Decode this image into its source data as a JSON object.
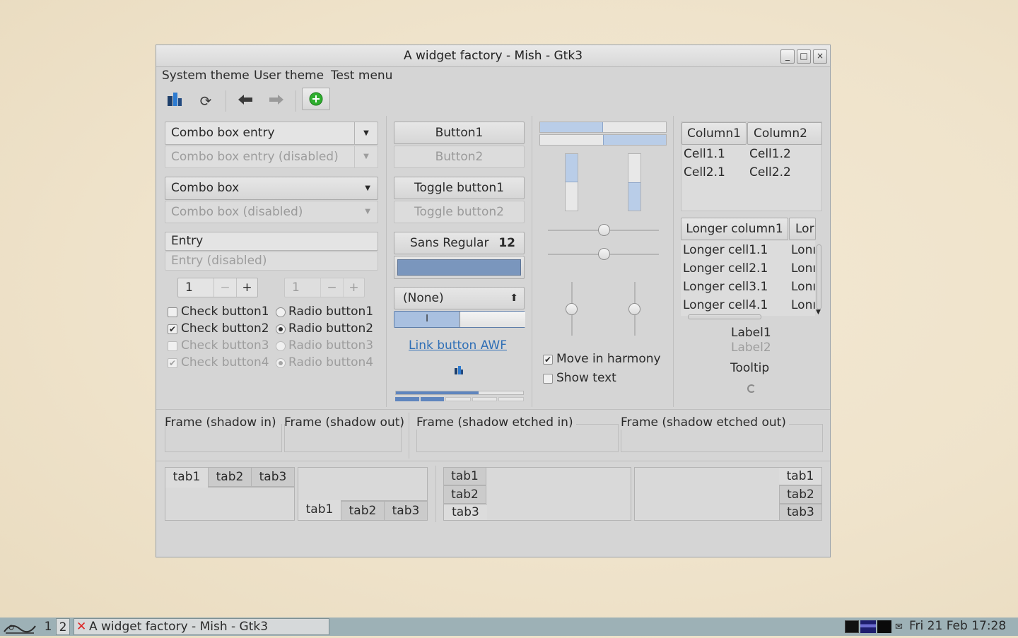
{
  "window": {
    "title": "A widget factory - Mish - Gtk3",
    "wm_buttons": {
      "minimize": "_",
      "maximize": "□",
      "close": "×"
    }
  },
  "menubar": [
    "System theme",
    "User theme",
    "Test menu"
  ],
  "toolbar": {
    "icons": [
      "app-icon",
      "refresh-icon",
      "back-icon",
      "forward-icon",
      "add-icon"
    ]
  },
  "col1": {
    "combo_entry": "Combo box entry",
    "combo_entry_disabled": "Combo box entry (disabled)",
    "combo_box": "Combo box",
    "combo_box_disabled": "Combo box (disabled)",
    "entry": "Entry",
    "entry_disabled": "Entry (disabled)",
    "spin1": {
      "value": "1",
      "minus": "−",
      "plus": "+"
    },
    "spin2": {
      "value": "1",
      "minus": "−",
      "plus": "+"
    },
    "checks": [
      {
        "label": "Check button1",
        "checked": false,
        "disabled": false
      },
      {
        "label": "Check button2",
        "checked": true,
        "disabled": false
      },
      {
        "label": "Check button3",
        "checked": false,
        "disabled": true
      },
      {
        "label": "Check button4",
        "checked": true,
        "disabled": true
      }
    ],
    "radios": [
      {
        "label": "Radio button1",
        "checked": false,
        "disabled": false
      },
      {
        "label": "Radio button2",
        "checked": true,
        "disabled": false
      },
      {
        "label": "Radio button3",
        "checked": false,
        "disabled": true
      },
      {
        "label": "Radio button4",
        "checked": true,
        "disabled": true
      }
    ]
  },
  "col2": {
    "button1": "Button1",
    "button2": "Button2",
    "toggle1": "Toggle button1",
    "toggle2": "Toggle button2",
    "font_name": "Sans Regular",
    "font_size": "12",
    "color_swatch": "#7a96bd",
    "file_chooser": "(None)",
    "switch_on_text": "I",
    "link": "Link button AWF",
    "progress_top": 0.65
  },
  "col3": {
    "hprogress1": 0.5,
    "hprogress2": 0.5,
    "vprogress1": 0.5,
    "vprogress2": 0.5,
    "hscale1": 0.5,
    "hscale2": 0.5,
    "vscale1": 0.5,
    "vscale2": 0.5,
    "move_in_harmony": "Move in harmony",
    "show_text": "Show text"
  },
  "col4": {
    "tree1": {
      "columns": [
        "Column1",
        "Column2"
      ],
      "rows": [
        [
          "Cell1.1",
          "Cell1.2"
        ],
        [
          "Cell2.1",
          "Cell2.2"
        ]
      ]
    },
    "tree2": {
      "columns": [
        "Longer column1",
        "Lor"
      ],
      "rows": [
        [
          "Longer cell1.1",
          "Lonı"
        ],
        [
          "Longer cell2.1",
          "Lonı"
        ],
        [
          "Longer cell3.1",
          "Lonı"
        ],
        [
          "Longer cell4.1",
          "Lonı"
        ]
      ]
    },
    "label1": "Label1",
    "label2": "Label2",
    "tooltip": "Tooltip"
  },
  "frames": [
    "Frame (shadow in)",
    "Frame (shadow out)",
    "Frame (shadow etched in)",
    "Frame (shadow etched out)"
  ],
  "tabs": [
    "tab1",
    "tab2",
    "tab3"
  ],
  "taskbar": {
    "workspaces": [
      "1",
      "2"
    ],
    "task": "A widget factory - Mish - Gtk3",
    "clock": "Fri 21 Feb 17:28"
  },
  "colors": {
    "accent": "#a9c0e0",
    "link": "#2f6fb6",
    "taskbar": "#9db1b6",
    "add_green": "#2fae2f"
  }
}
